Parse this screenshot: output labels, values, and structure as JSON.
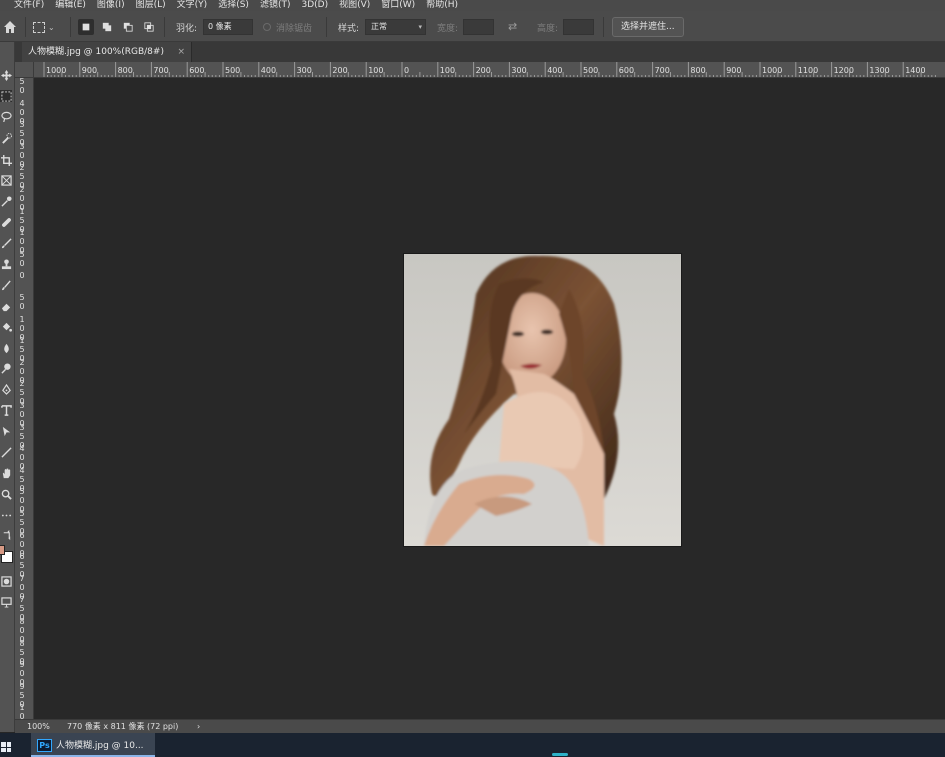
{
  "menu": [
    "文件(F)",
    "编辑(E)",
    "图像(I)",
    "图层(L)",
    "文字(Y)",
    "选择(S)",
    "滤镜(T)",
    "3D(D)",
    "视图(V)",
    "窗口(W)",
    "帮助(H)"
  ],
  "options": {
    "feather_label": "羽化:",
    "feather_value": "0 像素",
    "antialias_label": "消除锯齿",
    "style_label": "样式:",
    "style_value": "正常",
    "width_label": "宽度:",
    "height_label": "高度:",
    "mask_button": "选择并遮住..."
  },
  "document": {
    "tab_title": "人物模糊.jpg @ 100%(RGB/8#)",
    "tab_close": "×"
  },
  "ruler": {
    "top": [
      "1000",
      "900",
      "800",
      "700",
      "600",
      "500",
      "400",
      "300",
      "200",
      "100",
      "0",
      "100",
      "200",
      "300",
      "400",
      "500",
      "600",
      "700",
      "800",
      "900",
      "1000",
      "1100",
      "1200",
      "1300",
      "1400"
    ],
    "left": [
      [
        "5",
        "0"
      ],
      [
        "4",
        "0",
        "0"
      ],
      [
        "3",
        "5",
        "0"
      ],
      [
        "3",
        "0",
        "0"
      ],
      [
        "2",
        "5",
        "0"
      ],
      [
        "2",
        "0",
        "0"
      ],
      [
        "1",
        "5",
        "0"
      ],
      [
        "1",
        "0",
        "0"
      ],
      [
        "5",
        "0"
      ],
      [
        "0"
      ],
      [
        "5",
        "0"
      ],
      [
        "1",
        "0",
        "0"
      ],
      [
        "1",
        "5",
        "0"
      ],
      [
        "2",
        "0",
        "0"
      ],
      [
        "2",
        "5",
        "0"
      ],
      [
        "3",
        "0",
        "0"
      ],
      [
        "3",
        "5",
        "0"
      ],
      [
        "4",
        "0",
        "0"
      ],
      [
        "4",
        "5",
        "0"
      ],
      [
        "5",
        "0",
        "0"
      ],
      [
        "5",
        "5",
        "0"
      ],
      [
        "6",
        "0",
        "0"
      ],
      [
        "6",
        "5",
        "0"
      ],
      [
        "7",
        "0",
        "0"
      ],
      [
        "7",
        "5",
        "0"
      ],
      [
        "8",
        "0",
        "0"
      ],
      [
        "8",
        "5",
        "0"
      ],
      [
        "9",
        "0",
        "0"
      ],
      [
        "9",
        "5",
        "0"
      ],
      [
        "1",
        "0",
        "0",
        "0"
      ]
    ]
  },
  "status": {
    "zoom": "100%",
    "info": "770 像素 x 811 像素 (72 ppi)",
    "arrow": "›"
  },
  "taskbar": {
    "app_icon": "Ps",
    "app_title": "人物模糊.jpg @ 10..."
  },
  "colors": {
    "foreground": "#d79a85",
    "background": "#ffffff",
    "canvas": "#282828",
    "panel": "#535353"
  }
}
